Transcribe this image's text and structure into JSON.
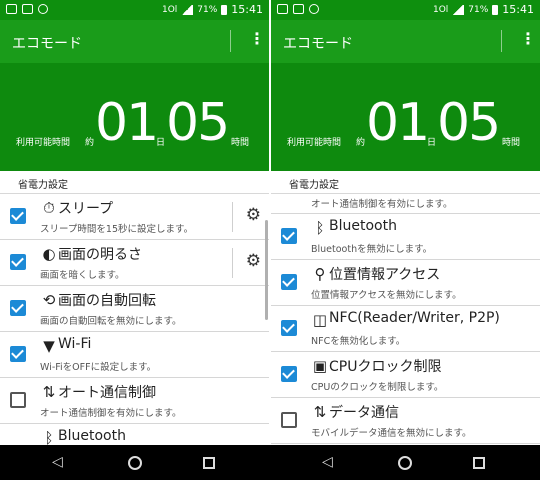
{
  "status": {
    "signal": "1Ol",
    "battery": "71%",
    "time": "15:41"
  },
  "appbar": {
    "title": "エコモード",
    "more": "⋮"
  },
  "hero": {
    "label_usable": "利用可能時間",
    "label_approx": "約",
    "hours": "01",
    "label_day": "日",
    "minutes": "05",
    "label_hours": "時間"
  },
  "section_label": "省電力設定",
  "left_items": [
    {
      "title": "スリープ",
      "desc": "スリープ時間を15秒に設定します。",
      "checked": true,
      "icon": "timer-icon",
      "settings": true
    },
    {
      "title": "画面の明るさ",
      "desc": "画面を暗くします。",
      "checked": true,
      "icon": "brightness-icon",
      "settings": true
    },
    {
      "title": "画面の自動回転",
      "desc": "画面の自動回転を無効にします。",
      "checked": true,
      "icon": "rotate-icon",
      "settings": false
    },
    {
      "title": "Wi-Fi",
      "desc": "Wi-FiをOFFに設定します。",
      "checked": true,
      "icon": "wifi-icon",
      "settings": false
    },
    {
      "title": "オート通信制御",
      "desc": "オート通信制御を有効にします。",
      "checked": false,
      "icon": "auto-sync-icon",
      "settings": false
    },
    {
      "title": "Bluetooth",
      "desc": "",
      "checked": true,
      "icon": "bluetooth-icon",
      "settings": false
    }
  ],
  "right_items": [
    {
      "title": "",
      "desc": "オート通信制御を有効にします。",
      "checked": false,
      "icon": "",
      "settings": false
    },
    {
      "title": "Bluetooth",
      "desc": "Bluetoothを無効にします。",
      "checked": true,
      "icon": "bluetooth-icon",
      "settings": false
    },
    {
      "title": "位置情報アクセス",
      "desc": "位置情報アクセスを無効にします。",
      "checked": true,
      "icon": "location-icon",
      "settings": false
    },
    {
      "title": "NFC(Reader/Writer, P2P)",
      "desc": "NFCを無効化します。",
      "checked": true,
      "icon": "nfc-icon",
      "settings": false
    },
    {
      "title": "CPUクロック制限",
      "desc": "CPUのクロックを制限します。",
      "checked": true,
      "icon": "cpu-icon",
      "settings": false
    },
    {
      "title": "データ通信",
      "desc": "モバイルデータ通信を無効にします。",
      "checked": false,
      "icon": "data-icon",
      "settings": false
    }
  ],
  "nav": {
    "back": "◁"
  }
}
